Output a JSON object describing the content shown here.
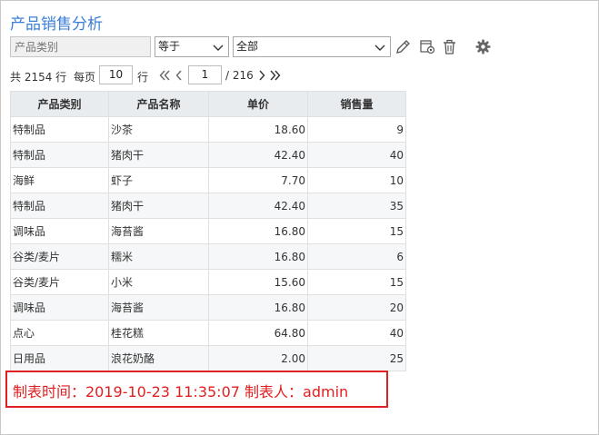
{
  "title": "产品销售分析",
  "filter": {
    "field_placeholder": "产品类别",
    "operator": "等于",
    "value": "全部",
    "icons": [
      "edit-icon",
      "copy-settings-icon",
      "delete-icon",
      "settings-icon"
    ]
  },
  "pager": {
    "total_label": "共 2154 行",
    "per_page_label": "每页",
    "per_page_value": "10",
    "row_unit": "行",
    "current_page": "1",
    "total_pages": "/ 216"
  },
  "table": {
    "headers": [
      "产品类别",
      "产品名称",
      "单价",
      "销售量"
    ],
    "rows": [
      [
        "特制品",
        "沙茶",
        "18.60",
        "9"
      ],
      [
        "特制品",
        "猪肉干",
        "42.40",
        "40"
      ],
      [
        "海鲜",
        "虾子",
        "7.70",
        "10"
      ],
      [
        "特制品",
        "猪肉干",
        "42.40",
        "35"
      ],
      [
        "调味品",
        "海苔酱",
        "16.80",
        "15"
      ],
      [
        "谷类/麦片",
        "糯米",
        "16.80",
        "6"
      ],
      [
        "谷类/麦片",
        "小米",
        "15.60",
        "15"
      ],
      [
        "调味品",
        "海苔酱",
        "16.80",
        "20"
      ],
      [
        "点心",
        "桂花糕",
        "64.80",
        "40"
      ],
      [
        "日用品",
        "浪花奶酪",
        "2.00",
        "25"
      ]
    ]
  },
  "footer": {
    "text": "制表时间：2019-10-23 11:35:07 制表人：admin"
  },
  "colors": {
    "title": "#3a7fd5",
    "footer_highlight": "#e02020",
    "header_bg": "#e9ecef"
  }
}
